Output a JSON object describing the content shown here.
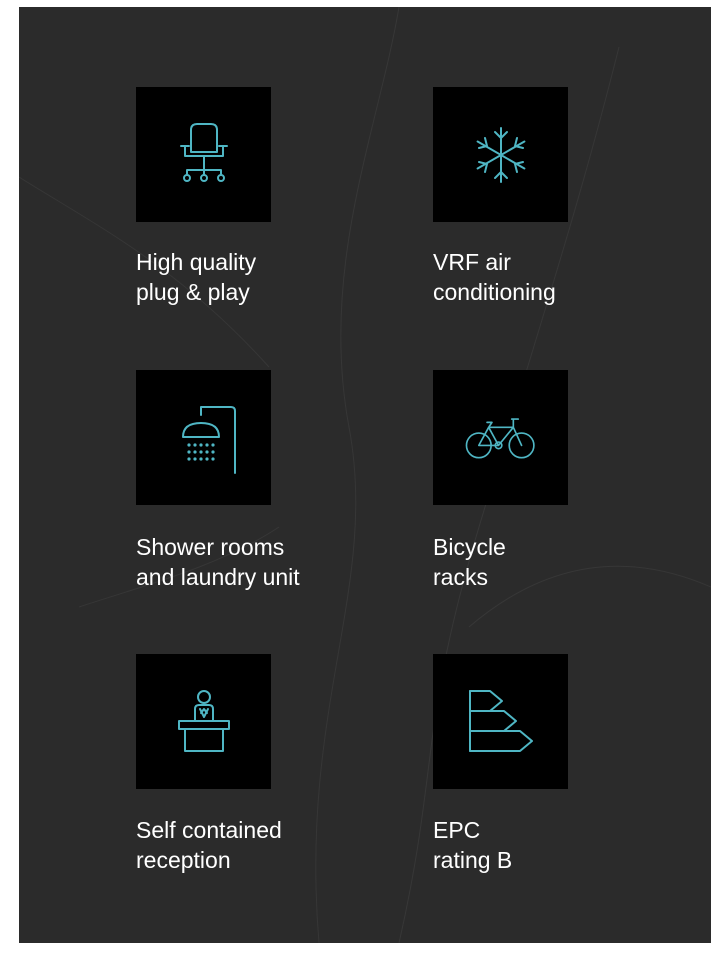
{
  "colors": {
    "panel_bg": "#2b2b2b",
    "tile_bg": "#000000",
    "icon_accent": "#4fb6c4",
    "caption_text": "#ffffff"
  },
  "features": [
    {
      "icon": "office-chair-icon",
      "line1": "High quality",
      "line2": "plug & play"
    },
    {
      "icon": "snowflake-icon",
      "line1": "VRF air",
      "line2": "conditioning"
    },
    {
      "icon": "shower-icon",
      "line1": "Shower rooms",
      "line2": "and laundry unit"
    },
    {
      "icon": "bicycle-icon",
      "line1": "Bicycle",
      "line2": "racks"
    },
    {
      "icon": "reception-desk-icon",
      "line1": "Self contained",
      "line2": "reception"
    },
    {
      "icon": "epc-rating-icon",
      "line1": "EPC",
      "line2": "rating B"
    }
  ]
}
